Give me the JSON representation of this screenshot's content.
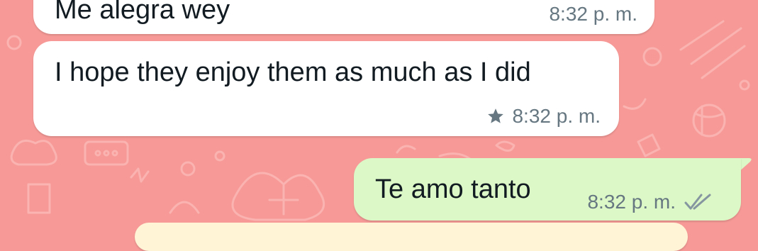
{
  "colors": {
    "wallpaper": "#f79a97",
    "incoming_bubble": "#ffffff",
    "outgoing_bubble": "#dcf8c6",
    "message_text": "#111b21",
    "meta_text": "#667781"
  },
  "messages": [
    {
      "direction": "incoming",
      "text": "Me alegra wey",
      "time": "8:32 p. m.",
      "starred": false
    },
    {
      "direction": "incoming",
      "text": "I hope they enjoy them as much as I did",
      "time": "8:32 p. m.",
      "starred": true,
      "star_icon": "star-icon"
    },
    {
      "direction": "outgoing",
      "text": "Te amo tanto",
      "time": "8:32 p. m.",
      "status_icon": "double-check-icon"
    }
  ]
}
